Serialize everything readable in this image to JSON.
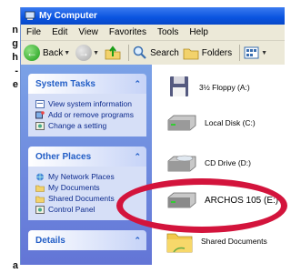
{
  "side_text": [
    "n",
    "g",
    "h",
    "-",
    "e"
  ],
  "side_text_bottom": "a",
  "window": {
    "title": "My Computer"
  },
  "menu": [
    "File",
    "Edit",
    "View",
    "Favorites",
    "Tools",
    "Help"
  ],
  "toolbar": {
    "back": "Back",
    "search": "Search",
    "folders": "Folders"
  },
  "task_panels": [
    {
      "title": "System Tasks",
      "items": [
        "View system information",
        "Add or remove programs",
        "Change a setting"
      ]
    },
    {
      "title": "Other Places",
      "items": [
        "My Network Places",
        "My Documents",
        "Shared Documents",
        "Control Panel"
      ]
    },
    {
      "title": "Details",
      "items": []
    }
  ],
  "drives": [
    {
      "label": "3½ Floppy (A:)",
      "icon": "floppy-icon"
    },
    {
      "label": "Local Disk (C:)",
      "icon": "hard-disk-icon"
    },
    {
      "label": "CD Drive (D:)",
      "icon": "cd-drive-icon"
    },
    {
      "label": "ARCHOS 105 (E:)",
      "icon": "removable-disk-icon"
    },
    {
      "label": "Shared Documents",
      "icon": "folder-icon"
    }
  ],
  "colors": {
    "highlight_ring": "#d3143c",
    "titlebar": "#0a54e0",
    "taskpane": "#6375d6"
  }
}
